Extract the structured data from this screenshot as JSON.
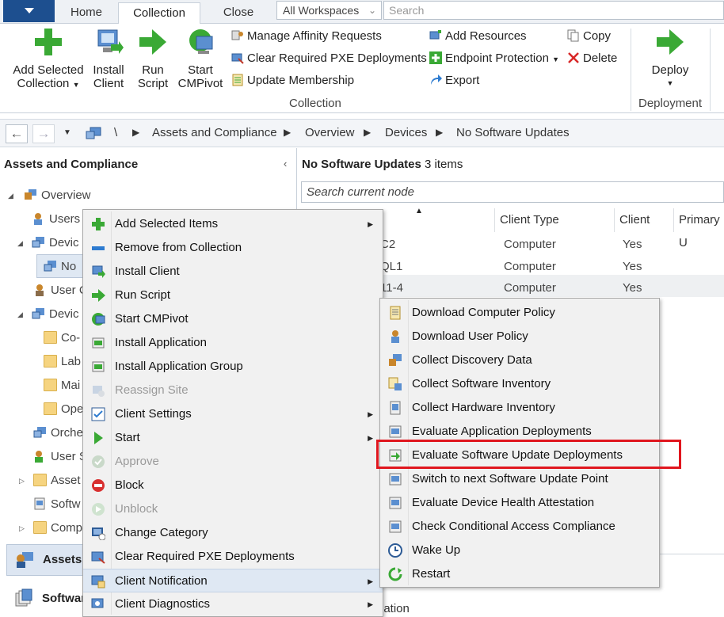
{
  "tabs": {
    "home": "Home",
    "collection": "Collection",
    "close": "Close"
  },
  "workspaces": {
    "value": "All Workspaces"
  },
  "search": {
    "placeholder": "Search"
  },
  "ribbon": {
    "add_selected_line1": "Add Selected",
    "add_selected_line2": "Collection",
    "install_client_line1": "Install",
    "install_client_line2": "Client",
    "run_script_line1": "Run",
    "run_script_line2": "Script",
    "start_cmpivot_line1": "Start",
    "start_cmpivot_line2": "CMPivot",
    "manage_affinity": "Manage Affinity Requests",
    "clear_pxe": "Clear Required PXE Deployments",
    "update_membership": "Update Membership",
    "add_resources": "Add Resources",
    "endpoint_protection": "Endpoint Protection",
    "export": "Export",
    "copy": "Copy",
    "delete": "Delete",
    "collection_group": "Collection",
    "deploy": "Deploy",
    "deployment_group": "Deployment"
  },
  "breadcrumb": {
    "root": "\\",
    "items": [
      "Assets and Compliance",
      "Overview",
      "Devices",
      "No Software Updates"
    ]
  },
  "left_pane": {
    "title": "Assets and Compliance",
    "tree": [
      "Overview",
      "Users",
      "Devic",
      "No",
      "User C",
      "Devic",
      "Co-",
      "Lab",
      "Mai",
      "Ope",
      "Orche",
      "User S",
      "Asset",
      "Softw",
      "Comp"
    ],
    "wunderbar": [
      "Assets a",
      "Softwar"
    ]
  },
  "right_pane": {
    "title_bold": "No Software Updates",
    "title_count": "3 items",
    "search_placeholder": "Search current node",
    "columns": [
      "Client Type",
      "Client",
      "Primary U"
    ],
    "rows": [
      {
        "name": "C2",
        "type": "Computer",
        "client": "Yes"
      },
      {
        "name": "QL1",
        "type": "Computer",
        "client": "Yes"
      },
      {
        "name": "11-4",
        "type": "Computer",
        "client": "Yes"
      }
    ],
    "bottom_text": "nation"
  },
  "context_menu": [
    {
      "label": "Add Selected Items",
      "submenu": true,
      "disabled": false,
      "icon": "add-icon"
    },
    {
      "label": "Remove from Collection",
      "submenu": false,
      "disabled": false,
      "icon": "remove-icon"
    },
    {
      "label": "Install Client",
      "submenu": false,
      "disabled": false,
      "icon": "install-icon"
    },
    {
      "label": "Run Script",
      "submenu": false,
      "disabled": false,
      "icon": "run-icon"
    },
    {
      "label": "Start CMPivot",
      "submenu": false,
      "disabled": false,
      "icon": "cmpivot-icon"
    },
    {
      "label": "Install Application",
      "submenu": false,
      "disabled": false,
      "icon": "install-app-icon"
    },
    {
      "label": "Install Application Group",
      "submenu": false,
      "disabled": false,
      "icon": "install-app-group-icon"
    },
    {
      "label": "Reassign Site",
      "submenu": false,
      "disabled": true,
      "icon": "reassign-icon"
    },
    {
      "label": "Client Settings",
      "submenu": true,
      "disabled": false,
      "icon": "settings-icon"
    },
    {
      "label": "Start",
      "submenu": true,
      "disabled": false,
      "icon": "start-icon"
    },
    {
      "label": "Approve",
      "submenu": false,
      "disabled": true,
      "icon": "approve-icon"
    },
    {
      "label": "Block",
      "submenu": false,
      "disabled": false,
      "icon": "block-icon"
    },
    {
      "label": "Unblock",
      "submenu": false,
      "disabled": true,
      "icon": "unblock-icon"
    },
    {
      "label": "Change Category",
      "submenu": false,
      "disabled": false,
      "icon": "category-icon"
    },
    {
      "label": "Clear Required PXE Deployments",
      "submenu": false,
      "disabled": false,
      "icon": "pxe-icon"
    },
    {
      "label": "Client Notification",
      "submenu": true,
      "disabled": false,
      "icon": "notification-icon"
    },
    {
      "label": "Client Diagnostics",
      "submenu": true,
      "disabled": false,
      "icon": "diagnostics-icon"
    }
  ],
  "submenu": [
    {
      "label": "Download Computer Policy",
      "icon": "policy-icon"
    },
    {
      "label": "Download User Policy",
      "icon": "user-policy-icon"
    },
    {
      "label": "Collect Discovery Data",
      "icon": "discovery-icon"
    },
    {
      "label": "Collect Software Inventory",
      "icon": "sw-inventory-icon"
    },
    {
      "label": "Collect Hardware Inventory",
      "icon": "hw-inventory-icon"
    },
    {
      "label": "Evaluate Application Deployments",
      "icon": "app-eval-icon"
    },
    {
      "label": "Evaluate Software Update Deployments",
      "icon": "update-eval-icon"
    },
    {
      "label": "Switch to next Software Update Point",
      "icon": "switch-sup-icon"
    },
    {
      "label": "Evaluate Device Health Attestation",
      "icon": "health-icon"
    },
    {
      "label": "Check Conditional Access Compliance",
      "icon": "compliance-icon"
    },
    {
      "label": "Wake Up",
      "icon": "clock-icon"
    },
    {
      "label": "Restart",
      "icon": "restart-icon"
    }
  ],
  "colors": {
    "accent": "#1d4f8f",
    "highlight": "#e0161e",
    "green": "#3aa935"
  }
}
